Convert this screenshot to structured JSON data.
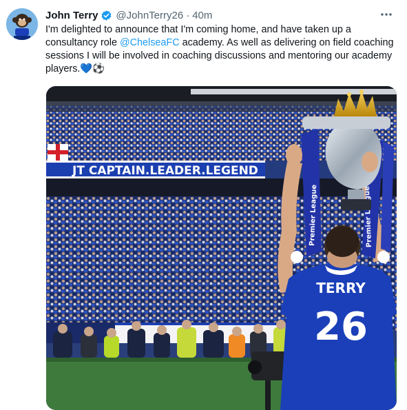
{
  "tweet": {
    "display_name": "John Terry",
    "handle": "@JohnTerry26",
    "separator": "·",
    "time": "40m",
    "text_part1": "I'm delighted to announce that I'm coming home, and have taken up a consultancy role ",
    "mention": "@ChelseaFC",
    "text_part2": " academy. As well as delivering on field coaching sessions I will be involved in coaching discussions and mentoring our academy players.",
    "emojis": "💙⚽"
  },
  "photo": {
    "banner_text": "JT CAPTAIN.LEADER.LEGEND",
    "shirt_name": "TERRY",
    "shirt_number": "26",
    "sash_text": "Premier League"
  },
  "colors": {
    "accent": "#1d9bf0",
    "chelsea_blue": "#1a3fb8",
    "text_primary": "#0f1419",
    "text_secondary": "#536471"
  },
  "icons": {
    "verified": "verified-badge-icon",
    "more": "more-options-icon"
  }
}
